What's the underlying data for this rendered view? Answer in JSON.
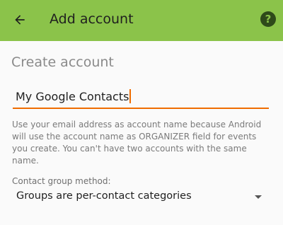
{
  "toolbar": {
    "title": "Add account",
    "back_icon": "arrow-back-icon",
    "help_icon": "help-icon",
    "help_glyph": "?",
    "color": "#8bc34a"
  },
  "form": {
    "section_title": "Create account",
    "account_name": {
      "value": "My Google Contacts",
      "accent_color": "#ef6c00"
    },
    "helper_text": "Use your email address as account name because Android will use the account name as ORGANIZER field for events you create. You can't have two accounts with the same name.",
    "group_method": {
      "label": "Contact group method:",
      "selected": "Groups are per-contact categories"
    }
  }
}
